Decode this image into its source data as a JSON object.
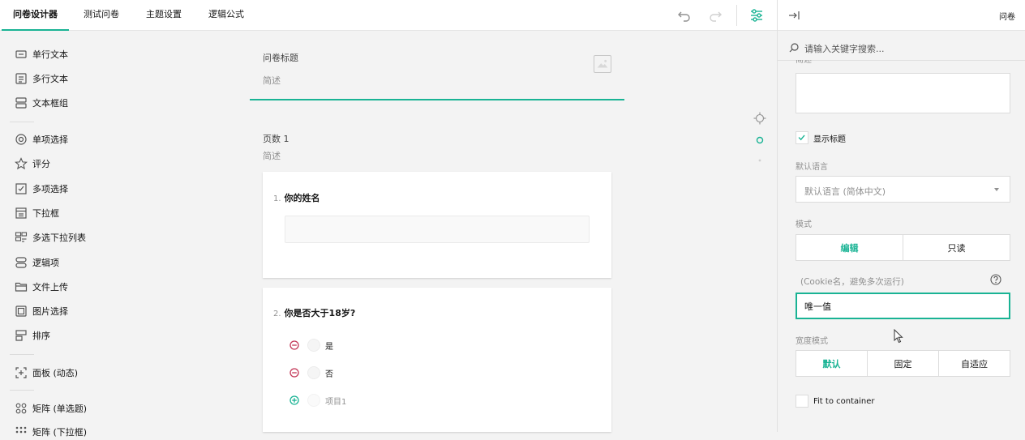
{
  "app": {
    "tabs": [
      {
        "label": "问卷设计器",
        "active": true
      },
      {
        "label": "测试问卷",
        "active": false
      },
      {
        "label": "主题设置",
        "active": false
      },
      {
        "label": "逻辑公式",
        "active": false
      }
    ]
  },
  "toolbar": {
    "undo_icon": "undo-icon",
    "redo_icon": "redo-icon",
    "settings_icon": "settings-sliders-icon"
  },
  "toolbox": {
    "items": [
      {
        "label": "单行文本",
        "icon": "single-line-text-icon"
      },
      {
        "label": "多行文本",
        "icon": "multi-line-text-icon"
      },
      {
        "label": "文本框组",
        "icon": "multiple-text-icon"
      },
      {
        "label": "单项选择",
        "icon": "radio-icon"
      },
      {
        "label": "评分",
        "icon": "star-icon"
      },
      {
        "label": "多项选择",
        "icon": "checkbox-icon"
      },
      {
        "label": "下拉框",
        "icon": "dropdown-icon"
      },
      {
        "label": "多选下拉列表",
        "icon": "tagbox-icon"
      },
      {
        "label": "逻辑项",
        "icon": "boolean-icon"
      },
      {
        "label": "文件上传",
        "icon": "folder-icon"
      },
      {
        "label": "图片选择",
        "icon": "image-picker-icon"
      },
      {
        "label": "排序",
        "icon": "ranking-icon"
      },
      {
        "label": "面板 (动态)",
        "icon": "dynamic-panel-icon"
      },
      {
        "label": "矩阵 (单选题)",
        "icon": "matrix-icon"
      },
      {
        "label": "矩阵 (下拉框)",
        "icon": "matrix-dropdown-icon"
      }
    ]
  },
  "survey": {
    "title": "问卷标题",
    "description": "简述",
    "page": {
      "title": "页数 1",
      "description": "简述"
    },
    "questions": [
      {
        "number": "1.",
        "title": "你的姓名"
      },
      {
        "number": "2.",
        "title": "你是否大于18岁?",
        "choices": [
          "是",
          "否"
        ],
        "new_choice": "项目1"
      }
    ]
  },
  "property_grid": {
    "title": "问卷",
    "search_placeholder": "请输入关键字搜索...",
    "cut_label": "简述",
    "show_title_label": "显示标题",
    "show_title_checked": true,
    "default_language_label": "默认语言",
    "default_language_value": "默认语言 (简体中文)",
    "mode_label": "模式",
    "mode_options": [
      "编辑",
      "只读"
    ],
    "mode_selected": 0,
    "cookie_label": "(Cookie名，避免多次运行)",
    "cookie_value": "唯一值",
    "width_mode_label": "宽度模式",
    "width_mode_options": [
      "默认",
      "固定",
      "自适应"
    ],
    "width_mode_selected": 0,
    "fit_label": "Fit to container",
    "fit_checked": false
  },
  "colors": {
    "accent": "#19b394",
    "remove": "#c33757",
    "text": "#161616",
    "muted": "#909090"
  }
}
